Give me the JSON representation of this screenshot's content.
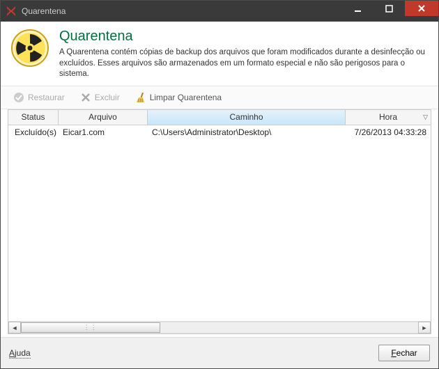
{
  "window": {
    "title": "Quarentena"
  },
  "header": {
    "title": "Quarentena",
    "description": "A Quarentena contém cópias de backup dos arquivos que foram modificados durante a desinfecção ou excluídos. Esses arquivos são armazenados em um formato especial e não são perigosos para o sistema."
  },
  "toolbar": {
    "restore_label": "Restaurar",
    "delete_label": "Excluir",
    "clear_label": "Limpar Quarentena"
  },
  "table": {
    "columns": {
      "status": "Status",
      "file": "Arquivo",
      "path": "Caminho",
      "time": "Hora"
    },
    "sorted_column": "path",
    "sort_direction_indicator": "▽",
    "rows": [
      {
        "status": "Excluído(s)",
        "file": "Eicar1.com",
        "path": "C:\\Users\\Administrator\\Desktop\\",
        "time": "7/26/2013 04:33:28"
      }
    ]
  },
  "footer": {
    "help_label": "Ajuda",
    "close_label": "Fechar"
  },
  "icons": {
    "app": "kaspersky-k",
    "hazard": "hazard-icon",
    "restore": "check-icon",
    "delete": "x-icon",
    "broom": "broom-icon",
    "warning": "warning-triangle-icon"
  }
}
